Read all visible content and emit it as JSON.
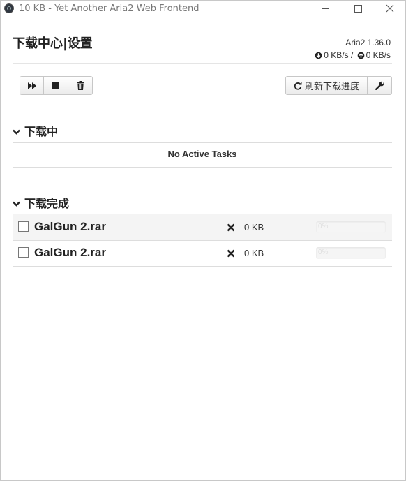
{
  "window": {
    "title": "10 KB - Yet Another Aria2 Web Frontend"
  },
  "header": {
    "title": "下载中心|设置",
    "version": "Aria2 1.36.0",
    "download_speed": "0 KB/s",
    "speed_separator": "/",
    "upload_speed": "0 KB/s"
  },
  "toolbar": {
    "left_buttons": [
      "fast-forward-icon",
      "stop-icon",
      "trash-icon"
    ],
    "refresh_label": "刷新下载进度",
    "settings_icon": "wrench-icon"
  },
  "active_section": {
    "title": "下载中",
    "empty_message": "No Active Tasks"
  },
  "completed_section": {
    "title": "下载完成",
    "tasks": [
      {
        "name": "GalGun 2.rar",
        "status_icon": "times-icon",
        "size": "0 KB",
        "progress_text": "0%",
        "progress": 0
      },
      {
        "name": "GalGun 2.rar",
        "status_icon": "times-icon",
        "size": "0 KB",
        "progress_text": "0%",
        "progress": 0
      }
    ]
  },
  "colors": {
    "accent": "#333333",
    "row_alt": "#f4f4f4",
    "border": "#dddddd"
  }
}
